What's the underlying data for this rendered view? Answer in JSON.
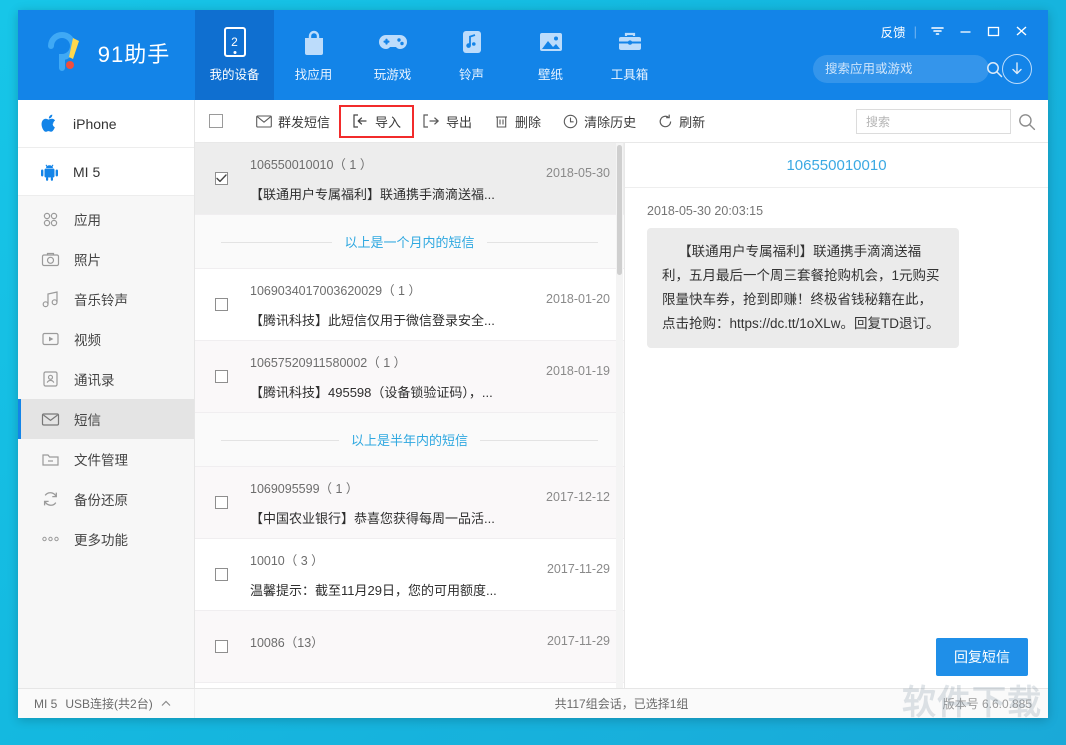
{
  "app": {
    "brand_name": "91助手",
    "colors": {
      "brand_blue": "#1384e8",
      "active_nav": "#0f6fd0",
      "accent_cyan": "#17c6e8",
      "link_blue": "#2fa8e0",
      "highlight_red": "#f22b2b",
      "reply_button": "#1f8fe8"
    }
  },
  "header": {
    "nav": [
      {
        "label": "我的设备",
        "icon": "device-screen-icon",
        "badge": "2",
        "active": true
      },
      {
        "label": "找应用",
        "icon": "shopping-bag-icon",
        "active": false
      },
      {
        "label": "玩游戏",
        "icon": "gamepad-icon",
        "active": false
      },
      {
        "label": "铃声",
        "icon": "music-note-icon",
        "active": false
      },
      {
        "label": "壁纸",
        "icon": "picture-icon",
        "active": false
      },
      {
        "label": "工具箱",
        "icon": "toolbox-icon",
        "active": false
      }
    ],
    "feedback_label": "反馈",
    "search_placeholder": "搜索应用或游戏",
    "search_value": "",
    "window_controls": [
      "dropdown",
      "minimize",
      "maximize",
      "close"
    ]
  },
  "sidebar": {
    "devices": [
      {
        "label": "iPhone",
        "icon": "apple-icon"
      },
      {
        "label": "MI 5",
        "icon": "android-icon"
      }
    ],
    "items": [
      {
        "label": "应用",
        "icon": "apps-grid-icon",
        "active": false
      },
      {
        "label": "照片",
        "icon": "camera-icon",
        "active": false
      },
      {
        "label": "音乐铃声",
        "icon": "music-icon",
        "active": false
      },
      {
        "label": "视频",
        "icon": "video-icon",
        "active": false
      },
      {
        "label": "通讯录",
        "icon": "contacts-icon",
        "active": false
      },
      {
        "label": "短信",
        "icon": "message-icon",
        "active": true
      },
      {
        "label": "文件管理",
        "icon": "folder-icon",
        "active": false
      },
      {
        "label": "备份还原",
        "icon": "sync-icon",
        "active": false
      },
      {
        "label": "更多功能",
        "icon": "more-dots-icon",
        "active": false
      }
    ]
  },
  "toolbar": {
    "buttons": [
      {
        "label": "群发短信",
        "icon": "envelope-icon",
        "highlighted": false
      },
      {
        "label": "导入",
        "icon": "import-arrow-icon",
        "highlighted": true
      },
      {
        "label": "导出",
        "icon": "export-arrow-icon",
        "highlighted": false
      },
      {
        "label": "删除",
        "icon": "trash-icon",
        "highlighted": false
      },
      {
        "label": "清除历史",
        "icon": "clock-icon",
        "highlighted": false
      },
      {
        "label": "刷新",
        "icon": "refresh-icon",
        "highlighted": false
      }
    ],
    "search_placeholder": "搜索",
    "search_value": "",
    "select_all_checked": false
  },
  "message_list": {
    "rows": [
      {
        "type": "message",
        "number": "106550010010（ 1 ）",
        "preview": "【联通用户专属福利】联通携手滴滴送福...",
        "date": "2018-05-30",
        "checked": true,
        "selected": true
      },
      {
        "type": "divider",
        "text": "以上是一个月内的短信"
      },
      {
        "type": "message",
        "number": "1069034017003620029（ 1 ）",
        "preview": "【腾讯科技】此短信仅用于微信登录安全...",
        "date": "2018-01-20",
        "checked": false,
        "selected": false
      },
      {
        "type": "message",
        "number": "10657520911580002（ 1 ）",
        "preview": "【腾讯科技】495598（设备锁验证码），...",
        "date": "2018-01-19",
        "checked": false,
        "selected": false
      },
      {
        "type": "divider",
        "text": "以上是半年内的短信"
      },
      {
        "type": "message",
        "number": "1069095599（ 1 ）",
        "preview": "【中国农业银行】恭喜您获得每周一品活...",
        "date": "2017-12-12",
        "checked": false,
        "selected": false
      },
      {
        "type": "message",
        "number": "10010（ 3 ）",
        "preview": "温馨提示：截至11月29日，您的可用额度...",
        "date": "2017-11-29",
        "checked": false,
        "selected": false
      },
      {
        "type": "message",
        "number": "10086（13）",
        "preview": "",
        "date": "2017-11-29",
        "checked": false,
        "selected": false
      }
    ]
  },
  "detail": {
    "title": "106550010010",
    "timestamp": "2018-05-30 20:03:15",
    "body": "【联通用户专属福利】联通携手滴滴送福利，五月最后一个周三套餐抢购机会，1元购买限量快车券，抢到即赚！终极省钱秘籍在此，点击抢购：https://dc.tt/1oXLw。回复TD退订。",
    "reply_label": "回复短信"
  },
  "statusbar": {
    "device": "MI 5",
    "connection": "USB连接(共2台)",
    "count_text": "共117组会话，已选择1组",
    "version": "版本号 6.6.0.885",
    "watermark": "软件下载"
  }
}
